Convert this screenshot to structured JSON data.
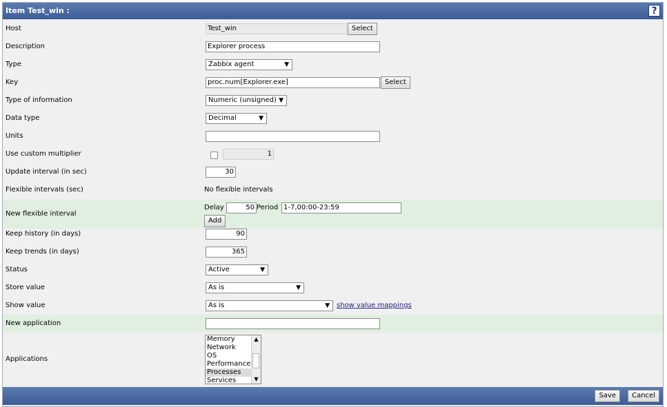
{
  "header": {
    "title": "Item Test_win :",
    "help_icon": "?"
  },
  "form": {
    "host": {
      "label": "Host",
      "value": "Test_win",
      "button": "Select"
    },
    "description": {
      "label": "Description",
      "value": "Explorer process"
    },
    "type": {
      "label": "Type",
      "value": "Zabbix agent"
    },
    "key": {
      "label": "Key",
      "value": "proc.num[Explorer.exe]",
      "button": "Select"
    },
    "type_of_information": {
      "label": "Type of information",
      "value": "Numeric (unsigned)"
    },
    "data_type": {
      "label": "Data type",
      "value": "Decimal"
    },
    "units": {
      "label": "Units",
      "value": ""
    },
    "custom_multiplier": {
      "label": "Use custom multiplier",
      "checked": false,
      "value": "1"
    },
    "update_interval": {
      "label": "Update interval (in sec)",
      "value": "30"
    },
    "flexible_intervals": {
      "label": "Flexible intervals (sec)",
      "value": "No flexible intervals"
    },
    "new_flexible_interval": {
      "label": "New flexible interval",
      "delay_label": "Delay",
      "delay_value": "50",
      "period_label": "Period",
      "period_value": "1-7,00:00-23:59",
      "add_button": "Add"
    },
    "keep_history": {
      "label": "Keep history (in days)",
      "value": "90"
    },
    "keep_trends": {
      "label": "Keep trends (in days)",
      "value": "365"
    },
    "status": {
      "label": "Status",
      "value": "Active"
    },
    "store_value": {
      "label": "Store value",
      "value": "As is"
    },
    "show_value": {
      "label": "Show value",
      "value": "As is",
      "link": "show value mappings"
    },
    "new_application": {
      "label": "New application",
      "value": ""
    },
    "applications": {
      "label": "Applications",
      "items": [
        "Memory",
        "Network",
        "OS",
        "Performance",
        "Processes",
        "Services"
      ],
      "selected": "Processes"
    }
  },
  "footer": {
    "save": "Save",
    "cancel": "Cancel"
  }
}
